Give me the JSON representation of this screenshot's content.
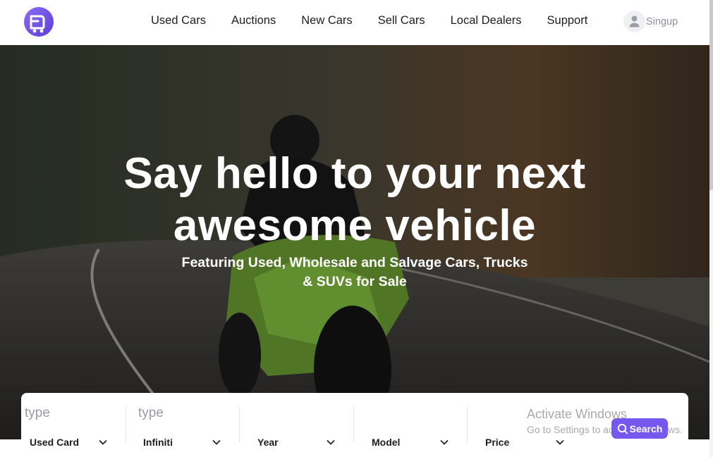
{
  "nav": {
    "items": [
      "Used Cars",
      "Auctions",
      "New Cars",
      "Sell Cars",
      "Local Dealers",
      "Support"
    ],
    "signup_label": "Singup",
    "logo_icon": "car-front-icon",
    "user_icon": "user-icon"
  },
  "hero": {
    "title_line1": "Say hello to your next",
    "title_line2": "awesome vehicle",
    "subtitle_line1": "Featuring Used, Wholesale and Salvage Cars, Trucks",
    "subtitle_line2": "& SUVs for Sale"
  },
  "search": {
    "fields": [
      {
        "placeholder": "type",
        "selected": "Used Card"
      },
      {
        "placeholder": "type",
        "selected": "Infiniti"
      },
      {
        "placeholder": "",
        "selected": "Year"
      },
      {
        "placeholder": "",
        "selected": "Model"
      },
      {
        "placeholder": "",
        "selected": "Price"
      }
    ],
    "button_label": "Search",
    "button_icon": "search-icon"
  },
  "watermark": {
    "title": "Activate Windows",
    "subtitle": "Go to Settings to activate Windows."
  },
  "colors": {
    "accent": "#7658ee",
    "logo_gradient_start": "#8a6cf3",
    "logo_gradient_end": "#5d3fd8",
    "text_dark": "#1d1d1f",
    "text_muted": "#8d9096"
  }
}
